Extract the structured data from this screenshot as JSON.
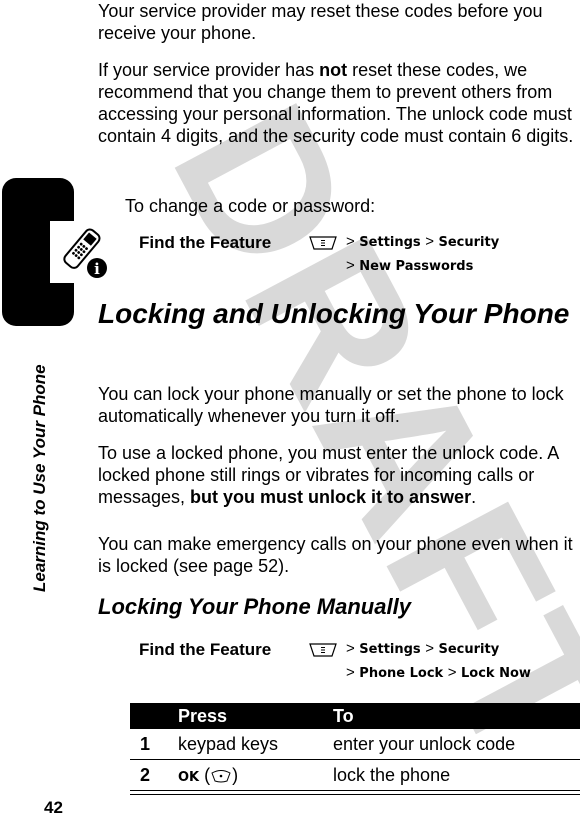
{
  "watermark": "DRAFT",
  "side_title": "Learning to Use Your Phone",
  "page_number": "42",
  "paragraphs": {
    "p1": "Your service provider may reset these codes before you receive your phone.",
    "p2_a": "If your service provider has ",
    "p2_bold": "not",
    "p2_b": " reset these codes, we recommend that you change them to prevent others from accessing your personal information. The unlock code must contain 4 digits, and the security code must contain 6 digits.",
    "p3": "To change a code or password:",
    "p4": "You can lock your phone manually or set the phone to lock automatically whenever you turn it off.",
    "p5_a": "To use a locked phone, you must enter the unlock code. A locked phone still rings or vibrates for incoming calls or messages, ",
    "p5_bold": "but you must unlock it to answer",
    "p5_b": ".",
    "p6": "You can make emergency calls on your phone even when it is locked (see page 52)."
  },
  "headings": {
    "h1": "Locking and Unlocking Your Phone",
    "h2": "Locking Your Phone Manually"
  },
  "find_feature_1": {
    "label": "Find the Feature",
    "menu_icon": "menu-key-icon",
    "line1": [
      "Settings",
      "Security"
    ],
    "line2": [
      "New Passwords"
    ]
  },
  "find_feature_2": {
    "label": "Find the Feature",
    "menu_icon": "menu-key-icon",
    "line1": [
      "Settings",
      "Security"
    ],
    "line2": [
      "Phone Lock",
      "Lock Now"
    ]
  },
  "table": {
    "headers": [
      "",
      "Press",
      "To"
    ],
    "rows": [
      {
        "num": "1",
        "press": "keypad keys",
        "to": "enter your unlock code"
      },
      {
        "num": "2",
        "press": "OK",
        "press_icon": "center-select-key-icon",
        "to": "lock the phone"
      }
    ]
  },
  "gt": ">"
}
